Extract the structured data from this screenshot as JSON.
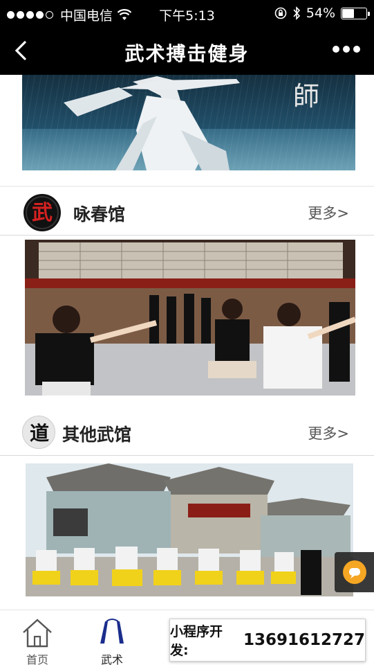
{
  "status_bar": {
    "carrier": "中国电信",
    "time": "下午5:13",
    "battery_text": "54%",
    "battery_level": 0.54
  },
  "nav": {
    "title": "武术搏击健身"
  },
  "sections": [
    {
      "logo_char": "武",
      "title": "咏春馆",
      "more": "更多>"
    },
    {
      "logo_char": "道",
      "title": "其他武馆",
      "more": "更多>"
    }
  ],
  "banner": {
    "overlay_glyph": "師"
  },
  "tabs": [
    {
      "label": "首页",
      "icon": "home-icon",
      "active": false
    },
    {
      "label": "武术",
      "icon": "nunchaku-icon",
      "active": true
    },
    {
      "label": "",
      "icon": "tab-icon-3",
      "active": false
    },
    {
      "label": "",
      "icon": "tab-icon-4",
      "active": false
    },
    {
      "label": "",
      "icon": "tab-icon-5",
      "active": false
    }
  ],
  "promo": {
    "label": "小程序开发:",
    "phone": "13691612727"
  },
  "colors": {
    "bar_bg": "#000000",
    "chat_accent": "#f5a623",
    "logo_red": "#d42121"
  }
}
